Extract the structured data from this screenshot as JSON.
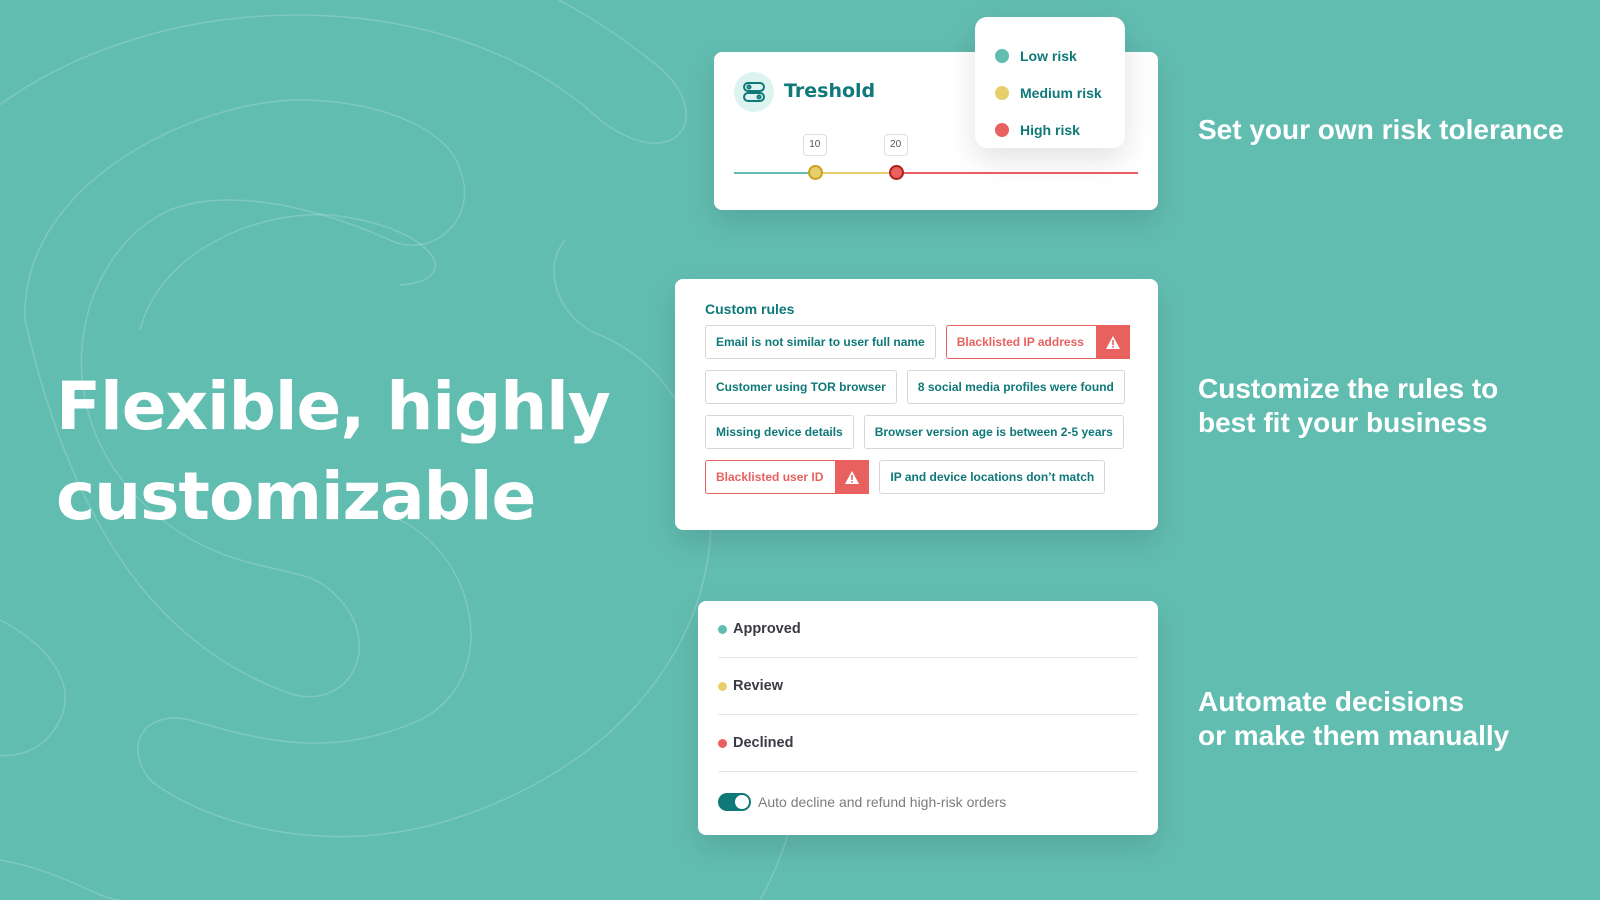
{
  "colors": {
    "background": "#62bdb1",
    "brand": "#0f7878",
    "low": "#62bdb1",
    "medium": "#e8cf6d",
    "high": "#e8615f"
  },
  "hero": {
    "line1": "Flexible, highly",
    "line2": "customizable"
  },
  "captions": {
    "risk": "Set your own risk tolerance",
    "rules_line1": "Customize the rules to",
    "rules_line2": "best fit your business",
    "decisions_line1": "Automate decisions",
    "decisions_line2": "or make them manually"
  },
  "threshold": {
    "title": "Treshold",
    "icon": "toggles-icon",
    "slider": {
      "min": 0,
      "max": 50,
      "medium_at": 10,
      "high_at": 20,
      "medium_label": "10",
      "high_label": "20"
    }
  },
  "legend": [
    {
      "label": "Low risk",
      "color": "#62bdb1"
    },
    {
      "label": "Medium risk",
      "color": "#e8cf6d"
    },
    {
      "label": "High risk",
      "color": "#e8615f"
    }
  ],
  "custom_rules": {
    "title": "Custom rules",
    "rows": [
      [
        {
          "label": "Email is not similar to user full name",
          "flagged": false
        },
        {
          "label": "Blacklisted IP address",
          "flagged": true
        }
      ],
      [
        {
          "label": "Customer using TOR browser",
          "flagged": false
        },
        {
          "label": "8 social media profiles were found",
          "flagged": false
        }
      ],
      [
        {
          "label": "Missing device details",
          "flagged": false
        },
        {
          "label": "Browser version age is between 2-5 years",
          "flagged": false
        }
      ],
      [
        {
          "label": "Blacklisted user ID",
          "flagged": true
        },
        {
          "label": "IP and device locations don’t match",
          "flagged": false
        }
      ]
    ]
  },
  "decisions": {
    "items": [
      {
        "label": "Approved",
        "color": "#62bdb1"
      },
      {
        "label": "Review",
        "color": "#e8cf6d"
      },
      {
        "label": "Declined",
        "color": "#e8615f"
      }
    ],
    "toggle_label": "Auto decline and refund high-risk orders",
    "toggle_on": true
  }
}
